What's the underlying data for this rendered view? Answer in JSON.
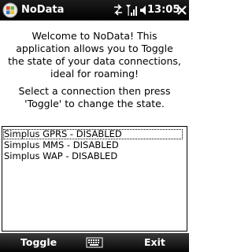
{
  "title_bar": {
    "app_title": "NoData",
    "time": "13:05",
    "icons": [
      "windows-start-icon",
      "data-sync-arrows-icon",
      "signal-strength-icon",
      "volume-icon",
      "close-icon"
    ]
  },
  "content": {
    "welcome_text": "Welcome to NoData! This application allows you to Toggle the state of your data connections, ideal for roaming!",
    "instruction_text": "Select a connection then press 'Toggle' to change the state.",
    "connections": [
      "Simplus GPRS - DISABLED",
      "Simplus MMS - DISABLED",
      "Simplus WAP - DISABLED"
    ],
    "focused_index": 0
  },
  "softkeys": {
    "left": "Toggle",
    "right": "Exit",
    "center_icon": "keyboard-icon"
  },
  "colors": {
    "bar_background": "#000000",
    "bar_text": "#ffffff",
    "content_background": "#ffffff",
    "text": "#000000"
  }
}
